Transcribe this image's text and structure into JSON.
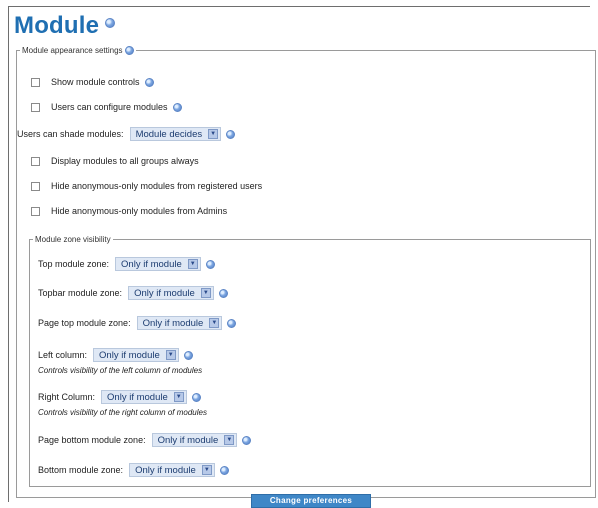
{
  "page": {
    "title": "Module"
  },
  "appearance": {
    "legend": "Module appearance settings",
    "show_controls": "Show module controls",
    "users_configure": "Users can configure modules",
    "shade_label": "Users can shade modules:",
    "shade_value": "Module decides",
    "display_all_groups": "Display modules to all groups always",
    "hide_anon_registered": "Hide anonymous-only modules from registered users",
    "hide_anon_admins": "Hide anonymous-only modules from Admins"
  },
  "zones": {
    "legend": "Module zone visibility",
    "top_label": "Top module zone:",
    "top_value": "Only if module",
    "topbar_label": "Topbar module zone:",
    "topbar_value": "Only if module",
    "pagetop_label": "Page top module zone:",
    "pagetop_value": "Only if module",
    "left_label": "Left column:",
    "left_value": "Only if module",
    "left_note": "Controls visibility of the left column of modules",
    "right_label": "Right Column:",
    "right_value": "Only if module",
    "right_note": "Controls visibility of the right column of modules",
    "pagebottom_label": "Page bottom module zone:",
    "pagebottom_value": "Only if module",
    "bottom_label": "Bottom module zone:",
    "bottom_value": "Only if module"
  },
  "actions": {
    "submit": "Change preferences"
  },
  "colors": {
    "title": "#1f6fb2",
    "select_bg": "#dfe8f5",
    "button_bg": "#3f87c7"
  },
  "icons": {
    "help": "help-icon",
    "dropdown": "dropdown-arrow-icon"
  }
}
